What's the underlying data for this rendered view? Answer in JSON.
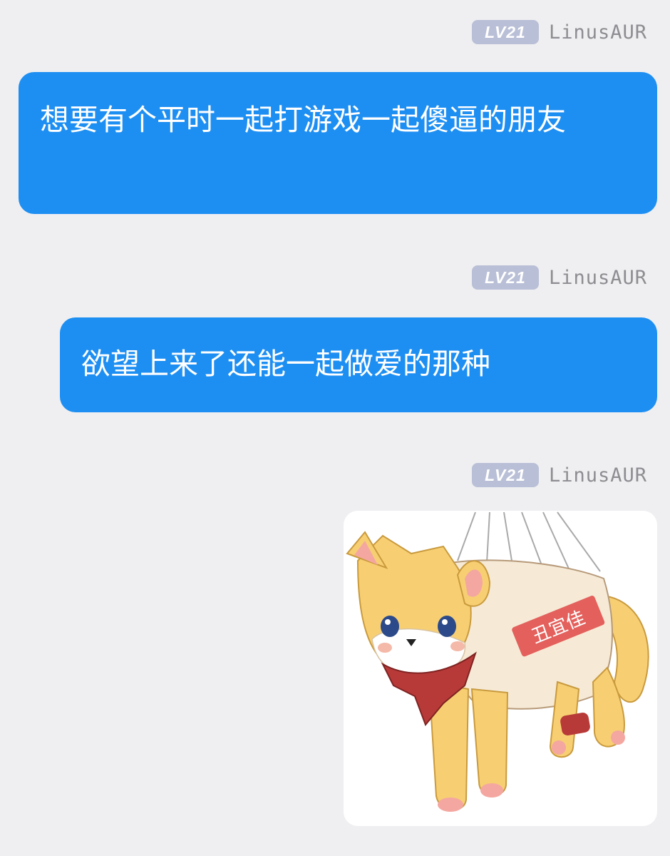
{
  "messages": [
    {
      "badge": "LV21",
      "user": "LinusAUR",
      "text": "想要有个平时一起打游戏一起傻逼的朋友"
    },
    {
      "badge": "LV21",
      "user": "LinusAUR",
      "text": "欲望上来了还能一起做爱的那种"
    },
    {
      "badge": "LV21",
      "user": "LinusAUR",
      "sticker": {
        "description_icon": "shiba-dog-in-bag-sticker",
        "bag_label": "丑宜佳"
      }
    }
  ],
  "colors": {
    "bubble": "#1e8ff2",
    "badge": "#b9bfd6",
    "background": "#efeff1",
    "username": "#8d8d92"
  }
}
